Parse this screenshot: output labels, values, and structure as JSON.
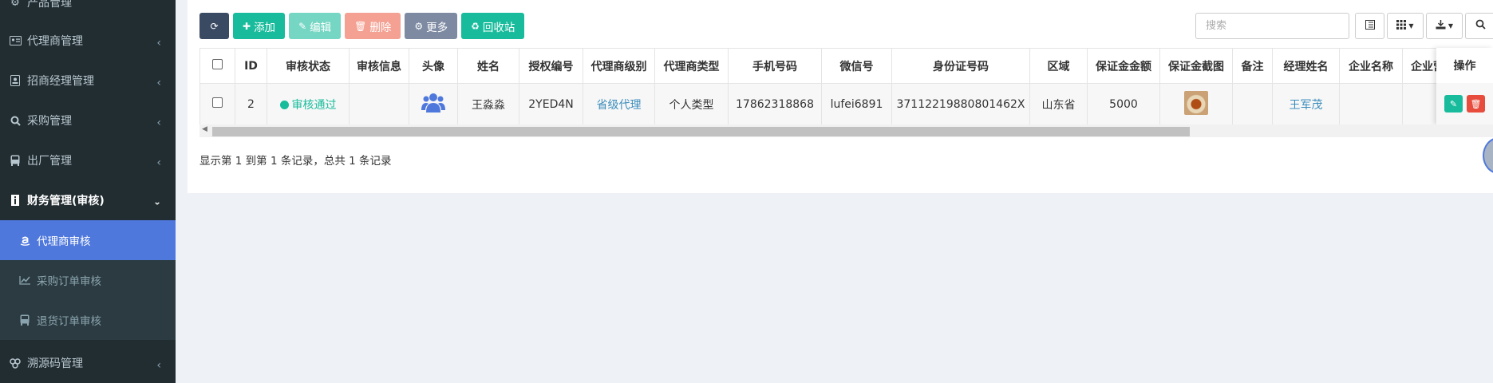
{
  "sidebar": {
    "items": [
      {
        "label": "产品管理",
        "icon": "gear-icon"
      },
      {
        "label": "代理商管理",
        "icon": "id-card-icon"
      },
      {
        "label": "招商经理管理",
        "icon": "portrait-icon"
      },
      {
        "label": "采购管理",
        "icon": "search-icon"
      },
      {
        "label": "出厂管理",
        "icon": "bus-icon"
      },
      {
        "label": "财务管理(审核)",
        "icon": "info-icon"
      },
      {
        "label": "代理商审核",
        "icon": "amazon-icon"
      },
      {
        "label": "采购订单审核",
        "icon": "line-chart-icon"
      },
      {
        "label": "退货订单审核",
        "icon": "bus-icon"
      },
      {
        "label": "溯源码管理",
        "icon": "cubes-icon"
      }
    ]
  },
  "toolbar": {
    "add": "添加",
    "edit": "编辑",
    "delete": "删除",
    "more": "更多",
    "recycle": "回收站",
    "search_placeholder": "搜索"
  },
  "table": {
    "headers": [
      "ID",
      "审核状态",
      "审核信息",
      "头像",
      "姓名",
      "授权编号",
      "代理商级别",
      "代理商类型",
      "手机号码",
      "微信号",
      "身份证号码",
      "区域",
      "保证金金额",
      "保证金截图",
      "备注",
      "经理姓名",
      "企业名称",
      "企业营"
    ],
    "action_header": "操作",
    "rows": [
      {
        "id": "2",
        "status": "审核通过",
        "info": "",
        "name": "王淼淼",
        "auth_no": "2YED4N",
        "level": "省级代理",
        "type": "个人类型",
        "phone": "17862318868",
        "wechat": "lufei6891",
        "id_card": "37112219880801462X",
        "region": "山东省",
        "deposit": "5000",
        "remark": "",
        "manager": "王军茂",
        "company": "",
        "company2": ""
      }
    ]
  },
  "summary": "显示第 1 到第 1 条记录，总共 1 条记录",
  "colors": {
    "sidebar_bg": "#222d32",
    "active": "#4f78dd",
    "success": "#18bc9c",
    "danger": "#e74c3c",
    "link": "#3c8dbc"
  }
}
